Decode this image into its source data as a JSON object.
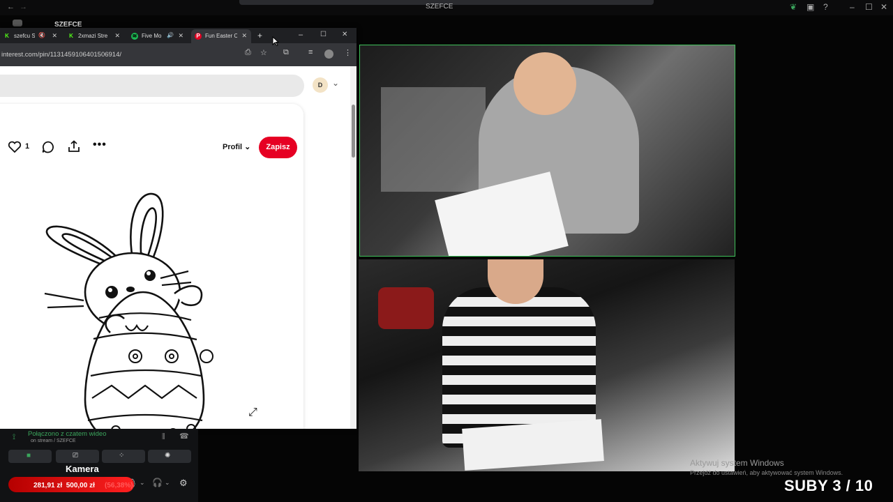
{
  "discord": {
    "server_title": "SZEFCE",
    "window_title": "SZEFCE",
    "voice_status": "Połączono z czatem wideo",
    "voice_channel": "on stream / SZEFCE",
    "camera_label": "Kamera"
  },
  "browser": {
    "tabs": [
      {
        "label": "szefcu St",
        "icon": "K",
        "color": "#53fc18"
      },
      {
        "label": "2xmazi Stre",
        "icon": "K",
        "color": "#53fc18"
      },
      {
        "label": "Five Mo",
        "icon": "spotify-icon",
        "color": "#1db954"
      },
      {
        "label": "Fun Easter C",
        "icon": "P",
        "color": "#e60023"
      }
    ],
    "url": "interest.com/pin/1131459106401506914/"
  },
  "pinterest": {
    "avatar_letter": "D",
    "like_count": "1",
    "profile_label": "Profil",
    "save_label": "Zapisz"
  },
  "goal": {
    "text": "281,91 zł  500,00 zł",
    "percent": "(56,38%)",
    "progress": 0.5638
  },
  "overlay": {
    "windows_activate": "Aktywuj system Windows",
    "windows_activate_sub": "Przejdź do ustawień, aby aktywować system Windows.",
    "suby": "SUBY 3 / 10"
  }
}
